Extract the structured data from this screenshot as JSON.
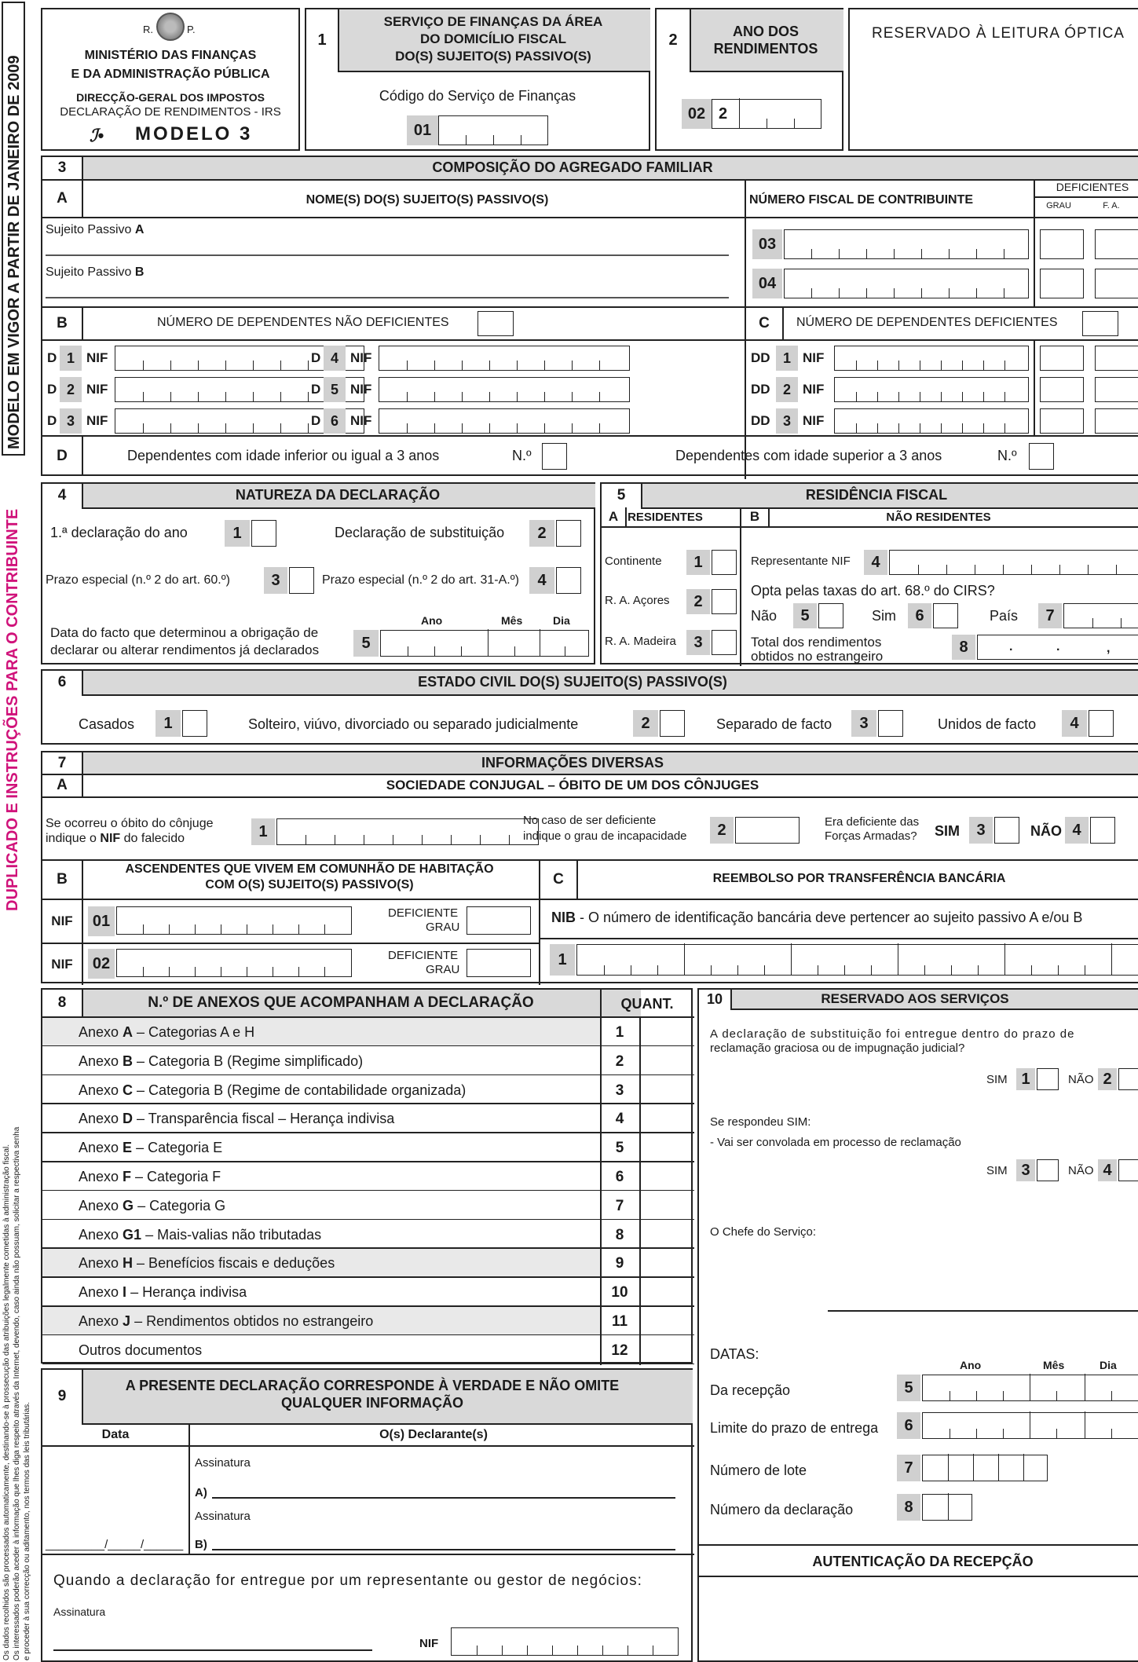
{
  "side": {
    "model_text": "MODELO EM VIGOR A PARTIR DE JANEIRO DE 2009",
    "copy_text": "DUPLICADO E INSTRUÇÕES PARA O CONTRIBUINTE",
    "legal_note_1": "Os dados recolhidos são processados automaticamente, destinando-se à prossecução das atribuições legalmente cometidas à administração fiscal.",
    "legal_note_2": "Os interessados poderão aceder à informação que lhes diga respeito através da Internet, devendo, caso ainda não possuam, solicitar a respectiva senha",
    "legal_note_3": "e proceder à sua correcção ou aditamento, nos termos das leis tributárias."
  },
  "header": {
    "emblem_left": "R.",
    "emblem_right": "P.",
    "ministry_1": "MINISTÉRIO DAS FINANÇAS",
    "ministry_2": "E DA ADMINISTRAÇÃO PÚBLICA",
    "dg": "DIRECÇÃO-GERAL DOS IMPOSTOS",
    "decl": "DECLARAÇÃO DE RENDIMENTOS - IRS",
    "model": "MODELO 3",
    "s1_num": "1",
    "s1_title_1": "SERVIÇO DE FINANÇAS DA ÁREA",
    "s1_title_2": "DO DOMICÍLIO FISCAL",
    "s1_title_3": "DO(S) SUJEITO(S) PASSIVO(S)",
    "s1_code_label": "Código do Serviço de Finanças",
    "s1_field": "01",
    "s2_num": "2",
    "s2_title_1": "ANO DOS",
    "s2_title_2": "RENDIMENTOS",
    "s2_field": "02",
    "s2_year_prefix": "2",
    "optic": "RESERVADO À LEITURA ÓPTICA"
  },
  "s3": {
    "num": "3",
    "title": "COMPOSIÇÃO DO AGREGADO FAMILIAR",
    "a_letter": "A",
    "a_title": "NOME(S) DO(S) SUJEITO(S) PASSIVO(S)",
    "nif_title": "NÚMERO FISCAL DE CONTRIBUINTE",
    "def_title": "DEFICIENTES",
    "grau": "GRAU",
    "fa": "F. A.",
    "sp_a": "Sujeito Passivo",
    "sp_a_letter": "A",
    "sp_b": "Sujeito Passivo",
    "sp_b_letter": "B",
    "f03": "03",
    "f04": "04",
    "b_letter": "B",
    "b_title": "NÚMERO DE DEPENDENTES NÃO DEFICIENTES",
    "c_letter": "C",
    "c_title": "NÚMERO DE DEPENDENTES DEFICIENTES",
    "nif": "NIF",
    "d": "D",
    "dd": "DD",
    "n1": "1",
    "n2": "2",
    "n3": "3",
    "n4": "4",
    "n5": "5",
    "n6": "6",
    "d_letter": "D",
    "d_le3": "Dependentes com idade inferior ou igual a 3 anos",
    "d_gt3": "Dependentes com idade superior a 3 anos",
    "n_label": "N.º"
  },
  "s4": {
    "num": "4",
    "title": "NATUREZA DA DECLARAÇÃO",
    "first": "1.ª declaração do ano",
    "subst": "Declaração de substituição",
    "prazo60": "Prazo especial (n.º 2 do art. 60.º)",
    "prazo31": "Prazo especial (n.º 2 do art. 31-A.º)",
    "date_l1": "Data do facto que determinou a obrigação de",
    "date_l2": "declarar ou alterar rendimentos já declarados",
    "ano": "Ano",
    "mes": "Mês",
    "dia": "Dia",
    "n1": "1",
    "n2": "2",
    "n3": "3",
    "n4": "4",
    "n5": "5"
  },
  "s5": {
    "num": "5",
    "title": "RESIDÊNCIA FISCAL",
    "a": "A",
    "residentes": "RESIDENTES",
    "b": "B",
    "nao_residentes": "NÃO RESIDENTES",
    "continente": "Continente",
    "acores": "R. A. Açores",
    "madeira": "R. A. Madeira",
    "rep": "Representante NIF",
    "opta": "Opta pelas taxas do art. 68.º do CIRS?",
    "nao": "Não",
    "sim": "Sim",
    "pais": "País",
    "total_1": "Total dos rendimentos",
    "total_2": "obtidos no estrangeiro",
    "n1": "1",
    "n2": "2",
    "n3": "3",
    "n4": "4",
    "n5": "5",
    "n6": "6",
    "n7": "7",
    "n8": "8"
  },
  "s6": {
    "num": "6",
    "title": "ESTADO CIVIL DO(S) SUJEITO(S) PASSIVO(S)",
    "casados": "Casados",
    "solteiro": "Solteiro, viúvo, divorciado ou separado judicialmente",
    "separado": "Separado de facto",
    "unidos": "Unidos de facto",
    "n1": "1",
    "n2": "2",
    "n3": "3",
    "n4": "4"
  },
  "s7": {
    "num": "7",
    "title": "INFORMAÇÕES DIVERSAS",
    "a": "A",
    "a_title": "SOCIEDADE CONJUGAL – ÓBITO DE UM DOS CÔNJUGES",
    "obito_1": "Se ocorreu o óbito do cônjuge",
    "obito_2a": "indique o",
    "obito_2b": "NIF",
    "obito_2c": "do falecido",
    "def_1": "No caso de ser deficiente",
    "def_2": "indique o grau de incapacidade",
    "fa_1": "Era deficiente das",
    "fa_2": "Forças Armadas?",
    "sim": "SIM",
    "nao": "NÃO",
    "n1": "1",
    "n2": "2",
    "n3": "3",
    "n4": "4",
    "b": "B",
    "b_title_1": "ASCENDENTES QUE VIVEM EM COMUNHÃO DE HABITAÇÃO",
    "b_title_2": "COM O(S) SUJEITO(S) PASSIVO(S)",
    "nif": "NIF",
    "f01": "01",
    "f02": "02",
    "deficiente": "DEFICIENTE",
    "grau": "GRAU",
    "c": "C",
    "c_title": "REEMBOLSO POR TRANSFERÊNCIA BANCÁRIA",
    "nib_b": "NIB",
    "nib_text": " - O número de identificação bancária deve pertencer ao sujeito passivo A e/ou B"
  },
  "s8": {
    "num": "8",
    "title": "N.º DE ANEXOS QUE ACOMPANHAM A DECLARAÇÃO",
    "quant": "QUANT.",
    "rows": [
      {
        "pre": "Anexo ",
        "letter": "A",
        "desc": " – Categorias A e H",
        "n": "1",
        "shade": true
      },
      {
        "pre": "Anexo ",
        "letter": "B",
        "desc": " – Categoria B (Regime simplificado)",
        "n": "2",
        "shade": false
      },
      {
        "pre": "Anexo ",
        "letter": "C",
        "desc": " – Categoria B (Regime de contabilidade organizada)",
        "n": "3",
        "shade": false
      },
      {
        "pre": "Anexo ",
        "letter": "D",
        "desc": " – Transparência fiscal  –  Herança indivisa",
        "n": "4",
        "shade": false
      },
      {
        "pre": "Anexo ",
        "letter": "E",
        "desc": " – Categoria E",
        "n": "5",
        "shade": false
      },
      {
        "pre": "Anexo ",
        "letter": "F",
        "desc": " – Categoria F",
        "n": "6",
        "shade": false
      },
      {
        "pre": "Anexo ",
        "letter": "G",
        "desc": " – Categoria G",
        "n": "7",
        "shade": false
      },
      {
        "pre": "Anexo ",
        "letter": "G1",
        "desc": " – Mais-valias não tributadas",
        "n": "8",
        "shade": false
      },
      {
        "pre": "Anexo ",
        "letter": "H",
        "desc": " – Benefícios fiscais e deduções",
        "n": "9",
        "shade": true
      },
      {
        "pre": "Anexo ",
        "letter": " I",
        "desc": " – Herança indivisa",
        "n": "10",
        "shade": false
      },
      {
        "pre": "Anexo ",
        "letter": "J",
        "desc": " – Rendimentos obtidos no estrangeiro",
        "n": "11",
        "shade": true
      },
      {
        "pre": "Outros documentos",
        "letter": "",
        "desc": "",
        "n": "12",
        "shade": false
      }
    ]
  },
  "s9": {
    "num": "9",
    "title_1": "A PRESENTE DECLARAÇÃO CORRESPONDE À VERDADE E NÃO OMITE",
    "title_2": "QUALQUER INFORMAÇÃO",
    "data": "Data",
    "declarantes": "O(s) Declarante(s)",
    "assinatura": "Assinatura",
    "a": "A)",
    "b": "B)",
    "date_fmt": "_________/_____/______",
    "rep_text": "Quando a declaração for entregue por um representante ou gestor de negócios:",
    "nif": "NIF"
  },
  "s10": {
    "num": "10",
    "title": "RESERVADO AOS SERVIÇOS",
    "q1_1": "A declaração de substituição foi entregue dentro do prazo de",
    "q1_2": "reclamação graciosa ou de impugnação judicial?",
    "sim": "SIM",
    "nao": "NÃO",
    "if_sim": "Se respondeu SIM:",
    "convolada": "- Vai ser convolada em processo de reclamação",
    "chefe": "O Chefe do Serviço:",
    "datas": "DATAS:",
    "ano": "Ano",
    "mes": "Mês",
    "dia": "Dia",
    "recepcao": "Da recepção",
    "limite": "Limite do prazo de entrega",
    "lote": "Número de lote",
    "decl": "Número da declaração",
    "auth": "AUTENTICAÇÃO DA RECEPÇÃO",
    "n1": "1",
    "n2": "2",
    "n3": "3",
    "n4": "4",
    "n5": "5",
    "n6": "6",
    "n7": "7",
    "n8": "8"
  }
}
